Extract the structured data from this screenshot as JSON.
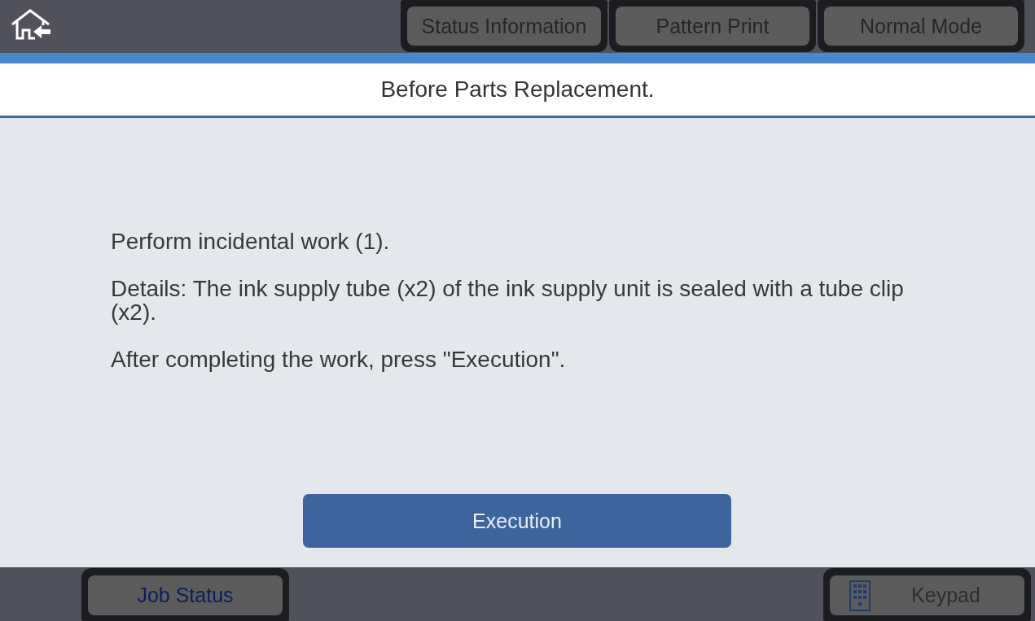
{
  "mode_buttons": [
    {
      "label": "Status Information"
    },
    {
      "label": "Pattern Print"
    },
    {
      "label": "Normal Mode"
    }
  ],
  "screen_title": "Before Parts Replacement.",
  "instructions": [
    "Perform incidental work (1).",
    "Details: The ink supply tube (x2) of the ink supply unit is sealed with a tube clip (x2).",
    "After completing the work, press \"Execution\"."
  ],
  "execute_button": {
    "label": "Execution"
  },
  "footer": {
    "job_status_button": {
      "label": "Job Status"
    },
    "keypad_button": {
      "label": "Keypad"
    }
  }
}
